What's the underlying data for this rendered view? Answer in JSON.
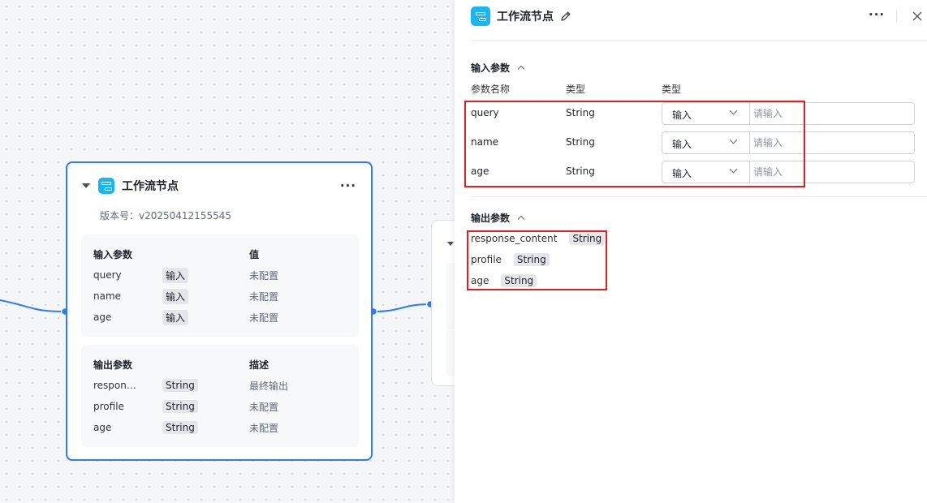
{
  "node": {
    "title": "工作流节点",
    "version": "版本号：v20250412155545",
    "input_section": {
      "heading": "输入参数",
      "value_heading": "值",
      "rows": [
        {
          "name": "query",
          "type": "输入",
          "value": "未配置"
        },
        {
          "name": "name",
          "type": "输入",
          "value": "未配置"
        },
        {
          "name": "age",
          "type": "输入",
          "value": "未配置"
        }
      ]
    },
    "output_section": {
      "heading": "输出参数",
      "desc_heading": "描述",
      "rows": [
        {
          "name": "respon…",
          "type": "String",
          "desc": "最终输出"
        },
        {
          "name": "profile",
          "type": "String",
          "desc": "未配置"
        },
        {
          "name": "age",
          "type": "String",
          "desc": "未配置"
        }
      ]
    }
  },
  "panel": {
    "title": "工作流节点",
    "input": {
      "heading": "输入参数",
      "col_name": "参数名称",
      "col_type": "类型",
      "col_type2": "类型",
      "rows": [
        {
          "name": "query",
          "type": "String",
          "select": "输入",
          "placeholder": "请输入"
        },
        {
          "name": "name",
          "type": "String",
          "select": "输入",
          "placeholder": "请输入"
        },
        {
          "name": "age",
          "type": "String",
          "select": "输入",
          "placeholder": "请输入"
        }
      ]
    },
    "output": {
      "heading": "输出参数",
      "rows": [
        {
          "name": "response_content",
          "type": "String"
        },
        {
          "name": "profile",
          "type": "String"
        },
        {
          "name": "age",
          "type": "String"
        }
      ]
    }
  },
  "colors": {
    "accent": "#2f7bf0",
    "icon": "#1ab6f1",
    "highlight": "#e02020"
  },
  "icons": [
    "workflow-icon",
    "edit-icon",
    "more-icon",
    "close-icon",
    "caret-down-icon",
    "chevron-up-icon",
    "chevron-down-icon"
  ]
}
